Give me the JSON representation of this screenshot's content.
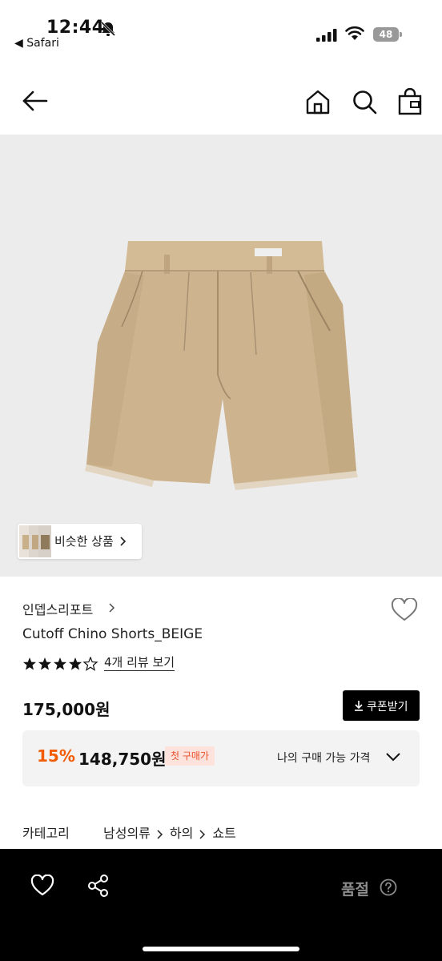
{
  "status_bar": {
    "time": "12:44",
    "back_app": "◀ Safari",
    "battery": "48"
  },
  "product": {
    "similar_label": "비슷한 상품",
    "brand": "인뎁스리포트",
    "title": "Cutoff Chino Shorts_BEIGE",
    "rating": 4.5,
    "review_link": "4개 리뷰 보기",
    "price": "175,000원",
    "coupon_button": "쿠폰받기",
    "discount": {
      "percent": "15%",
      "price": "148,750원",
      "badge": "첫 구매가",
      "my_price_label": "나의 구매 가능 가격"
    },
    "category": {
      "label": "카테고리",
      "path": [
        "남성의류",
        "하의",
        "쇼트"
      ]
    }
  },
  "bottom_bar": {
    "sold_out": "품절",
    "icons": [
      "heart-icon",
      "share-icon",
      "help-icon"
    ]
  },
  "colors": {
    "accent_discount": "#f25c05",
    "badge_bg": "#fde3dc",
    "bottom_bar": "#000000",
    "hero_bg": "#ececec",
    "product_beige": "#cdb48f"
  }
}
